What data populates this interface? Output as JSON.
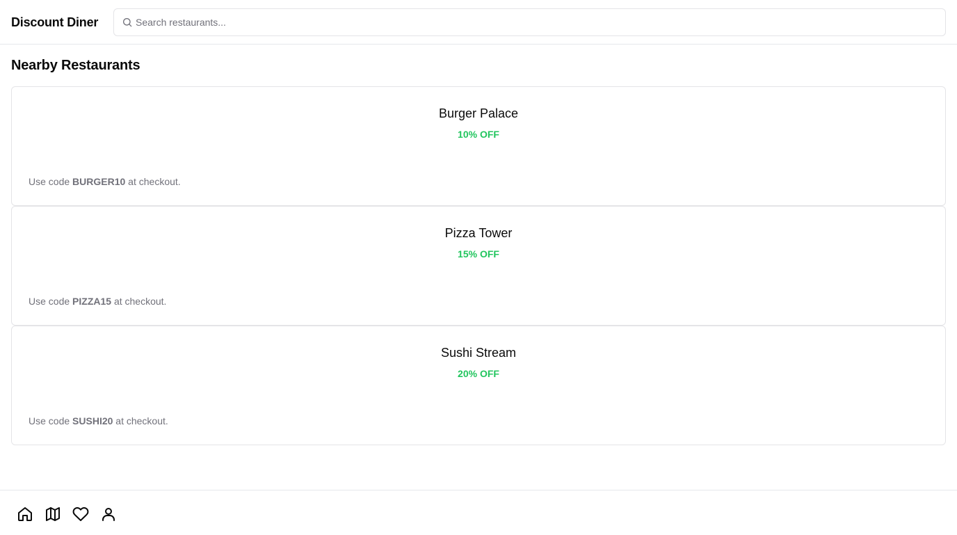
{
  "header": {
    "brand": "Discount Diner",
    "search": {
      "placeholder": "Search restaurants...",
      "value": ""
    }
  },
  "main": {
    "title": "Nearby Restaurants",
    "restaurants": [
      {
        "name": "Burger Palace",
        "discount": "10% OFF",
        "code_prefix": "Use code ",
        "code": "BURGER10",
        "code_suffix": " at checkout."
      },
      {
        "name": "Pizza Tower",
        "discount": "15% OFF",
        "code_prefix": "Use code ",
        "code": "PIZZA15",
        "code_suffix": " at checkout."
      },
      {
        "name": "Sushi Stream",
        "discount": "20% OFF",
        "code_prefix": "Use code ",
        "code": "SUSHI20",
        "code_suffix": " at checkout."
      }
    ]
  },
  "bottom_nav": {
    "items": [
      {
        "icon": "home-icon"
      },
      {
        "icon": "map-icon"
      },
      {
        "icon": "heart-icon"
      },
      {
        "icon": "user-icon"
      }
    ]
  },
  "colors": {
    "discount": "#22c55e",
    "muted_text": "#71717a",
    "border": "#e4e4e7"
  }
}
